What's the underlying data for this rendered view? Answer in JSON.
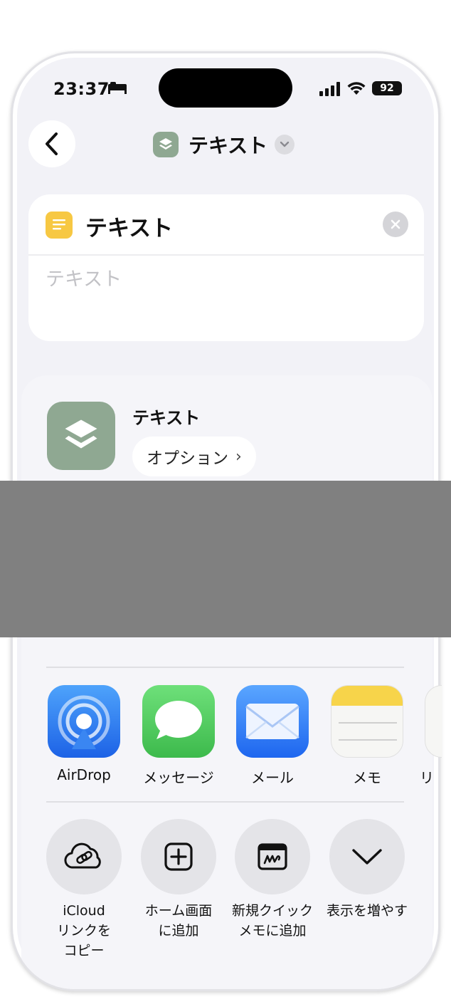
{
  "status": {
    "time": "23:37",
    "battery": "92"
  },
  "nav": {
    "title": "テキスト"
  },
  "text_card": {
    "title": "テキスト",
    "placeholder": "テキスト",
    "value": ""
  },
  "share": {
    "title": "テキスト",
    "options_label": "オプション"
  },
  "apps": [
    {
      "label": "AirDrop",
      "icon": "airdrop-icon"
    },
    {
      "label": "メッセージ",
      "icon": "messages-icon"
    },
    {
      "label": "メール",
      "icon": "mail-icon"
    },
    {
      "label": "メモ",
      "icon": "notes-icon"
    },
    {
      "label": "リ",
      "icon": "reminders-icon"
    }
  ],
  "actions": [
    {
      "label_lines": [
        "iCloud",
        "リンクを",
        "コピー"
      ],
      "icon": "icloud-link-icon"
    },
    {
      "label_lines": [
        "ホーム画面",
        "に追加"
      ],
      "icon": "add-square-icon"
    },
    {
      "label_lines": [
        "新規クイック",
        "メモに追加"
      ],
      "icon": "quick-note-icon"
    },
    {
      "label_lines": [
        "表示を増やす"
      ],
      "icon": "chevron-down-icon"
    }
  ],
  "colors": {
    "accent_messages": "#4fcb5e",
    "accent_mail": "#2f7df6",
    "accent_airdrop": "#2d7ff2",
    "shortcut_app": "#8fa892",
    "notes_yellow": "#f7c843"
  }
}
